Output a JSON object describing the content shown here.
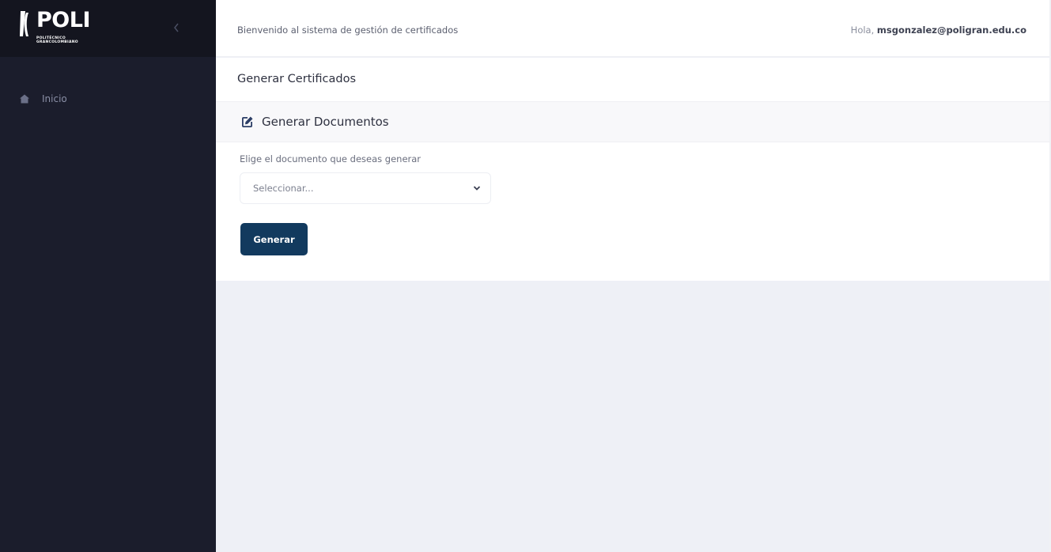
{
  "brand": {
    "name": "POLI",
    "tagline_line1": "POLITÉCNICO",
    "tagline_line2": "GRANCOLOMBIANO",
    "collapse_icon": "chevron-left-icon"
  },
  "sidebar": {
    "items": [
      {
        "label": "Inicio",
        "icon": "home-icon"
      }
    ]
  },
  "header": {
    "welcome_text": "Bienvenido al sistema de gestión de certificados",
    "greeting_prefix": "Hola,",
    "user_email": "msgonzalez@poligran.edu.co"
  },
  "main": {
    "page_title": "Generar Certificados",
    "card_title": "Generar Documentos",
    "card_icon": "edit-icon",
    "field_label": "Elige el documento que deseas generar",
    "select_value": "Seleccionar...",
    "generate_label": "Generar"
  },
  "colors": {
    "sidebar_bg": "#1b1d2c",
    "logo_bar_bg": "#14151f",
    "content_bg": "#eef0f6",
    "primary_button": "#123a5e"
  }
}
